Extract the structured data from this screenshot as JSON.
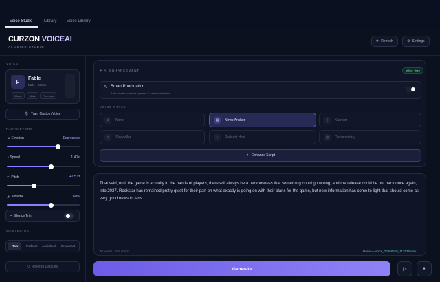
{
  "tabs": [
    "Voice Studio",
    "Library",
    "Voice Library"
  ],
  "brand": {
    "name_main": "CURZON ",
    "name_accent": "VOICEAI",
    "subtitle": "AI VOICE STUDIO"
  },
  "header_buttons": {
    "refresh": "Refresh",
    "settings": "Settings"
  },
  "sidebar": {
    "voice_label": "VOICE",
    "voice": {
      "initial": "F",
      "name": "Fable",
      "meta": "Male · British",
      "tags": [
        "Warm",
        "Male",
        "Premium"
      ]
    },
    "train_button": "Train Custom Voice",
    "parameters_label": "PARAMETERS",
    "params": [
      {
        "label": "Emotion",
        "value": "Expressive",
        "level": 0.7
      },
      {
        "label": "Speed",
        "value": "1.40×",
        "level": 0.6
      },
      {
        "label": "Pitch",
        "value": "+2.5 st",
        "level": 0.37
      },
      {
        "label": "Volume",
        "value": "60%",
        "level": 0.6
      }
    ],
    "silence_trim": "Silence Trim",
    "mastering_label": "MASTERING",
    "mastering_options": [
      "Raw",
      "Podcast",
      "Audiobook",
      "Broadcast"
    ],
    "mastering_selected": "Raw",
    "reset_button": "↺ Reset to Defaults"
  },
  "enhancement": {
    "title": "AI ENHANCEMENT",
    "badge": "offline · free",
    "punctuation_title": "Smart Punctuation",
    "punctuation_sub": "Auto-inserts commas, pauses & sentence breaks",
    "voice_style_label": "VOICE STYLE",
    "styles": [
      "None",
      "News Anchor",
      "Narrator",
      "Storyteller",
      "Podcast Host",
      "Documentary"
    ],
    "selected_style": "News Anchor",
    "enhance_button": "Enhance Script"
  },
  "script": {
    "text": "That said, until the game is actually in the hands of players, there will always be a nervousness that something could go wrong, and the release could be put back once again, into 2027. Rockstar has remained pretty quiet for their part on what exactly is going on with their plans for the game, but new information has come to light that should come as very good news to fans.",
    "stats": "70 words · 376 chars",
    "status": "Done — voice_20260618_112636.wav"
  },
  "generate_button": "Generate",
  "colors": {
    "accent": "#8b7dff",
    "success": "#5fc7a4",
    "background": "#0c1120"
  }
}
